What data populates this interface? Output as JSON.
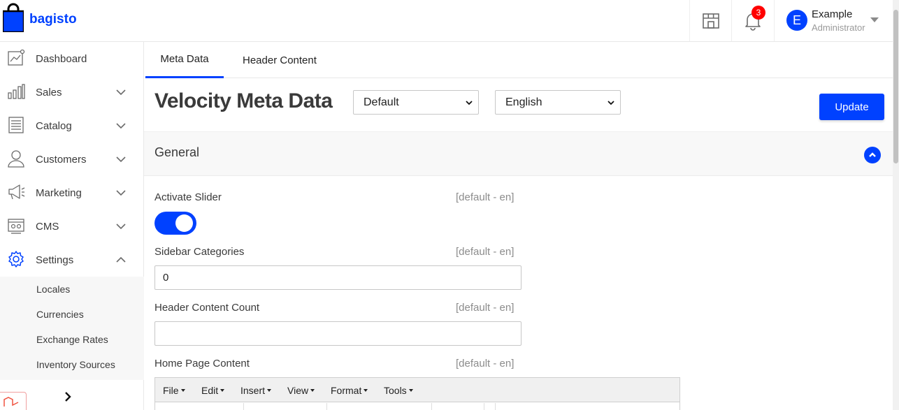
{
  "app": {
    "logo_text": "bagisto"
  },
  "header": {
    "notification_count": "3",
    "user": {
      "initial": "E",
      "name": "Example",
      "role": "Administrator"
    }
  },
  "sidebar": {
    "items": [
      {
        "label": "Dashboard",
        "icon": "dashboard-icon"
      },
      {
        "label": "Sales",
        "icon": "sales-icon"
      },
      {
        "label": "Catalog",
        "icon": "catalog-icon"
      },
      {
        "label": "Customers",
        "icon": "customers-icon"
      },
      {
        "label": "Marketing",
        "icon": "marketing-icon"
      },
      {
        "label": "CMS",
        "icon": "cms-icon"
      },
      {
        "label": "Settings",
        "icon": "settings-icon"
      }
    ],
    "settings_sub": [
      "Locales",
      "Currencies",
      "Exchange Rates",
      "Inventory Sources"
    ]
  },
  "tabs": [
    "Meta Data",
    "Header Content"
  ],
  "page": {
    "title": "Velocity Meta Data",
    "channel_select": "Default",
    "locale_select": "English",
    "update_label": "Update"
  },
  "general": {
    "title": "General",
    "fields": [
      {
        "label": "Activate Slider",
        "scope": "[default - en]",
        "value": ""
      },
      {
        "label": "Sidebar Categories",
        "scope": "[default - en]",
        "value": "0"
      },
      {
        "label": "Header Content Count",
        "scope": "[default - en]",
        "value": ""
      },
      {
        "label": "Home Page Content",
        "scope": "[default - en]",
        "value": ""
      }
    ]
  },
  "editor": {
    "menu": [
      "File",
      "Edit",
      "Insert",
      "View",
      "Format",
      "Tools"
    ]
  },
  "colors": {
    "accent": "#0041ff",
    "badge": "#ff0000"
  }
}
